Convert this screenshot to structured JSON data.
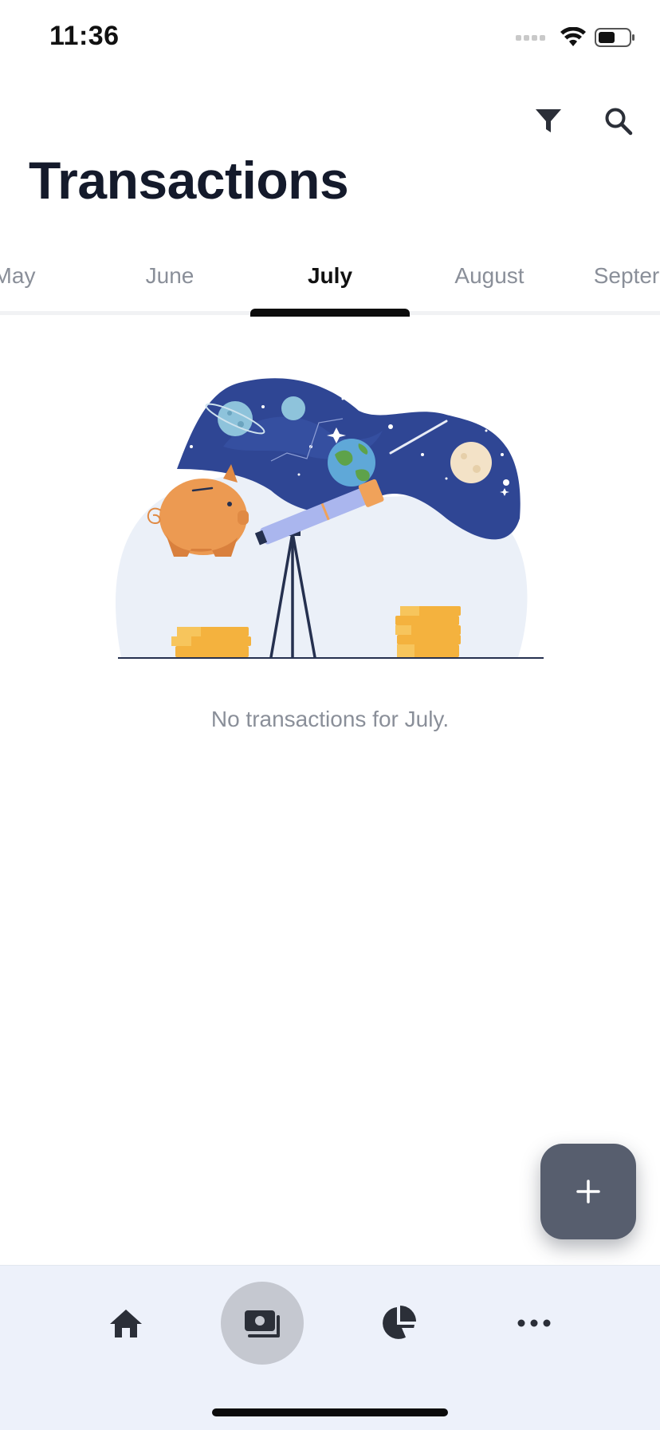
{
  "status_bar": {
    "time": "11:36",
    "icons": [
      "cellular-signal-icon",
      "wifi-icon",
      "battery-icon"
    ]
  },
  "header": {
    "title": "Transactions",
    "actions": [
      {
        "icon": "filter-icon"
      },
      {
        "icon": "search-icon"
      }
    ]
  },
  "month_tabs": {
    "items": [
      {
        "label": "May"
      },
      {
        "label": "June"
      },
      {
        "label": "July"
      },
      {
        "label": "August"
      },
      {
        "label": "Septer"
      }
    ],
    "active": "July"
  },
  "empty_state": {
    "illustration": "piggy-bank-telescope-space-illustration",
    "message": "No transactions for July."
  },
  "fab": {
    "icon": "plus-icon"
  },
  "bottom_nav": {
    "items": [
      {
        "icon": "home-icon",
        "active": false
      },
      {
        "icon": "transactions-icon",
        "active": true
      },
      {
        "icon": "pie-chart-icon",
        "active": false
      },
      {
        "icon": "more-icon",
        "active": false
      }
    ]
  },
  "colors": {
    "accent_dark": "#141a2b",
    "fab": "#575e6e",
    "nav_background": "#edf1fa",
    "active_nav_bubble": "#c5c8d0",
    "muted_text": "#8a8f99"
  }
}
